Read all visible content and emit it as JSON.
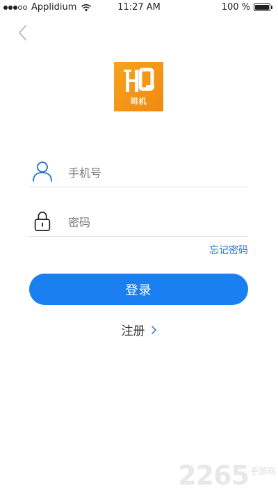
{
  "status_bar": {
    "carrier": "Applidium",
    "time": "11:27 AM",
    "battery": "100 %",
    "signal_bars_filled": 3,
    "signal_bars_total": 5
  },
  "logo": {
    "text": "司机",
    "color": "#f39a18",
    "mark": "HQ"
  },
  "login_form": {
    "phone_placeholder": "手机号",
    "password_placeholder": "密码",
    "forgot_password": "忘记密码",
    "login_button": "登录",
    "register_link": "注册"
  },
  "watermark": {
    "number": "2265",
    "sub": "手游网"
  },
  "icons": {
    "back": "chevron-left-icon",
    "phone_field": "user-icon",
    "password_field": "lock-icon",
    "register": "chevron-right-icon",
    "wifi": "wifi-icon",
    "battery": "battery-icon"
  },
  "colors": {
    "accent": "#1a7ff0",
    "link": "#1f6fd0",
    "user_icon": "#1f6fd0",
    "logo_bg": "#f39a18"
  }
}
